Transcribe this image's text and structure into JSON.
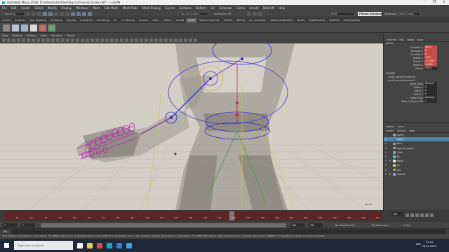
{
  "window": {
    "title": "Autodesk Maya 2018: D:\\video\\tutor\\OverRig_tutor\\Lord_Drunk.mb* --- joint9",
    "controls": [
      "–",
      "❐",
      "✕"
    ]
  },
  "menubar": [
    "File",
    "Edit",
    "Create",
    "Select",
    "Modify",
    "Display",
    "Windows",
    "Mesh",
    "Edit Mesh",
    "Mesh Tools",
    "Mesh Display",
    "Curves",
    "Surfaces",
    "Deform",
    "UV",
    "Generate",
    "Cache",
    "Arnold",
    "Redshift",
    "Help"
  ],
  "statusline": {
    "mode": "Modeling",
    "no_live_surface": "No Live Surface",
    "symmetry": "Symmetry: Off",
    "search_value": "joint9",
    "pose_editor": "Pinned Rainment",
    "workspace_label": "Workspace :",
    "workspace_value": "Maya Classic"
  },
  "shelf_tabs": [
    "Curves",
    "Surfaces",
    "Poly Modeling",
    "Sculpting",
    "Rigging",
    "Animation",
    "Rendering",
    "FX",
    "FX Caching",
    "Custom",
    "XGen",
    "Motion",
    "Arnold",
    "MASK",
    "Motion Graphics",
    "TURTLE",
    "Bifrost",
    "bcl_animation",
    "AdvancedSkeleton",
    "Bullet",
    "QuadRemesh",
    "Redshift",
    "SkinningTools"
  ],
  "active_shelf_tab": "MASK",
  "shelf_icons": [
    {
      "name": "create-icon",
      "color": "#8a8a8a"
    },
    {
      "name": "joint-icon",
      "color": "#b7c4d6"
    },
    {
      "name": "ik-icon",
      "color": "#9fb3c9"
    },
    {
      "name": "curve-icon",
      "color": "#d9d9d9"
    },
    {
      "name": "skin-icon",
      "color": "#c96a6a"
    },
    {
      "name": "paint-weights-icon",
      "color": "#6fa06f"
    }
  ],
  "panel": {
    "menu": [
      "View",
      "Shading",
      "Lighting",
      "Show",
      "Renderer",
      "Panels"
    ],
    "camera_label": "persp"
  },
  "channelbox": {
    "tabs": [
      "Channels",
      "Edit",
      "Object",
      "Show"
    ],
    "object": "joint9",
    "attributes": [
      {
        "name": "Translate X",
        "value": "38.21",
        "keyed": true
      },
      {
        "name": "Translate Y",
        "value": "0",
        "keyed": true
      },
      {
        "name": "Translate Z",
        "value": "0",
        "keyed": true
      },
      {
        "name": "Rotate X",
        "value": "-12.5",
        "keyed": true
      },
      {
        "name": "Rotate Y",
        "value": "-27.295",
        "keyed": true
      },
      {
        "name": "Rotate Z",
        "value": "-8.015",
        "keyed": true
      },
      {
        "name": "Radius",
        "value": "0.614",
        "keyed": false
      }
    ],
    "shapes_title": "SHAPES",
    "shapes": [
      "joint9_pointOConstraint1",
      "joint9_orientConstraint1"
    ],
    "inputs": [
      {
        "name": "Node State",
        "value": "Normal"
      },
      {
        "name": "Offset X",
        "value": "0"
      },
      {
        "name": "Offset Y",
        "value": "0"
      },
      {
        "name": "Offset Z",
        "value": "0"
      },
      {
        "name": "Interp Type",
        "value": "Average"
      },
      {
        "name": "Zblsv Left Joint W0",
        "value": "1"
      }
    ]
  },
  "layer_editor": {
    "tabs": [
      "Display",
      "Anim"
    ],
    "menu": [
      "Layers",
      "Options",
      "Help"
    ],
    "layers": [
      {
        "v": "",
        "p": "",
        "name": "layer6",
        "color": "#9a9a9a",
        "selected": false
      },
      {
        "v": "V",
        "p": "",
        "name": "layer1",
        "color": "#3a6fd8",
        "selected": true
      },
      {
        "v": "V",
        "p": "",
        "name": "Face",
        "color": "#9a9a9a",
        "selected": false
      },
      {
        "v": "V",
        "p": "",
        "name": "layer_fb_layer1",
        "color": "#9a9a9a",
        "selected": false
      },
      {
        "v": "V",
        "p": "",
        "name": "Cloth",
        "color": "#9a9a9a",
        "selected": false
      },
      {
        "v": "V",
        "p": "",
        "name": "Bo",
        "color": "#3fd9e0",
        "selected": false
      },
      {
        "v": "V",
        "p": "R",
        "name": "Model",
        "color": "#f0f0f0",
        "selected": false
      },
      {
        "v": "V",
        "p": "",
        "name": "fol",
        "color": "#f2e34b",
        "selected": false
      },
      {
        "v": "V",
        "p": "",
        "name": "fol2",
        "color": "#9a9a9a",
        "selected": false
      },
      {
        "v": "V",
        "p": "R",
        "name": "Ground",
        "color": "#6aa0e0",
        "selected": false
      }
    ]
  },
  "timeline": {
    "start": 1,
    "end": 264,
    "current": 160,
    "major_ticks": [
      "1",
      "10",
      "20",
      "30",
      "40",
      "50",
      "60",
      "70",
      "80",
      "90",
      "100",
      "110",
      "120",
      "130",
      "140",
      "150",
      "160",
      "170",
      "180",
      "190",
      "200",
      "210",
      "220",
      "230",
      "240",
      "250",
      "260"
    ],
    "current_frame_field": "160"
  },
  "range": {
    "start_field": "1",
    "inner_start": "1",
    "inner_end": "264",
    "end_field": "264",
    "character_set": "No Character Set",
    "anim_layer": "No Anim Layer",
    "fps": "24 fps"
  },
  "cmdline": {
    "mel_label": "MEL"
  },
  "helpline": "Show Rotation manipulator to move objects. Ctrl+RMB+drag to move components along normals. Shift+drag manipulator axis or plane handles to extrude components or clone objects. Ctrl+LMB+Shift+drag to rotate constrained to a connected edge. Use D or INSERT to change the pivot position and axis orientation.",
  "taskbar": {
    "search_placeholder": "Type here to search",
    "apps": [
      {
        "name": "task-view-icon",
        "color": "#ffffff"
      },
      {
        "name": "explorer-icon",
        "color": "#f2c94c"
      },
      {
        "name": "chrome-icon",
        "color": "#e0463a"
      },
      {
        "name": "maya-icon",
        "color": "#19a5c0"
      },
      {
        "name": "photoshop-icon",
        "color": "#2f7dd6"
      },
      {
        "name": "telegram-icon",
        "color": "#35a6e0"
      }
    ],
    "lang": "ENG",
    "time": "17:43",
    "date": "06.09.2021"
  }
}
